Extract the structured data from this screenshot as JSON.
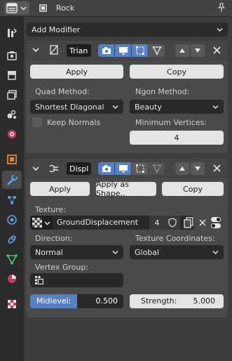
{
  "header": {
    "object_name": "Rock",
    "icons": [
      "editor-type-icon",
      "object-icon",
      "pin-icon"
    ]
  },
  "sidebar": {
    "tabs": [
      {
        "name": "tool",
        "icon": "tool-icon"
      },
      {
        "name": "render",
        "icon": "render-icon"
      },
      {
        "name": "output",
        "icon": "output-icon"
      },
      {
        "name": "view-layer",
        "icon": "view-layer-icon"
      },
      {
        "name": "scene",
        "icon": "scene-icon"
      },
      {
        "name": "world",
        "icon": "world-icon"
      },
      {
        "name": "object",
        "icon": "object-icon"
      },
      {
        "name": "modifiers",
        "icon": "wrench-icon",
        "active": true
      },
      {
        "name": "particles",
        "icon": "particles-icon"
      },
      {
        "name": "physics",
        "icon": "physics-icon"
      },
      {
        "name": "constraints",
        "icon": "constraints-icon"
      },
      {
        "name": "data",
        "icon": "mesh-data-icon"
      },
      {
        "name": "material",
        "icon": "material-icon"
      },
      {
        "name": "texture",
        "icon": "texture-icon"
      }
    ]
  },
  "add_modifier": {
    "label": "Add Modifier"
  },
  "triangulate": {
    "name": "Trian",
    "apply_label": "Apply",
    "copy_label": "Copy",
    "quad_method_label": "Quad Method:",
    "quad_method_value": "Shortest Diagonal",
    "ngon_method_label": "Ngon Method:",
    "ngon_method_value": "Beauty",
    "keep_normals_label": "Keep Normals",
    "keep_normals_checked": false,
    "min_vertices_label": "Minimum Vertices:",
    "min_vertices_value": "4"
  },
  "displace": {
    "name": "Displ",
    "apply_label": "Apply",
    "apply_shape_label": "Apply as Shape..",
    "copy_label": "Copy",
    "texture_label": "Texture:",
    "texture_name": "GroundDisplacement",
    "texture_users": "4",
    "direction_label": "Direction:",
    "direction_value": "Normal",
    "texcoords_label": "Texture Coordinates:",
    "texcoords_value": "Global",
    "vertex_group_label": "Vertex Group:",
    "vertex_group_value": "",
    "midlevel_label": "Midlevel:",
    "midlevel_value": "0.500",
    "midlevel_fraction": 0.5,
    "strength_label": "Strength:",
    "strength_value": "5.000"
  },
  "colors": {
    "accent": "#5680c2",
    "panel": "#4a4a4a",
    "background": "#3d3d3d",
    "field_dark": "#292929",
    "button_light": "#e4e4e4"
  }
}
